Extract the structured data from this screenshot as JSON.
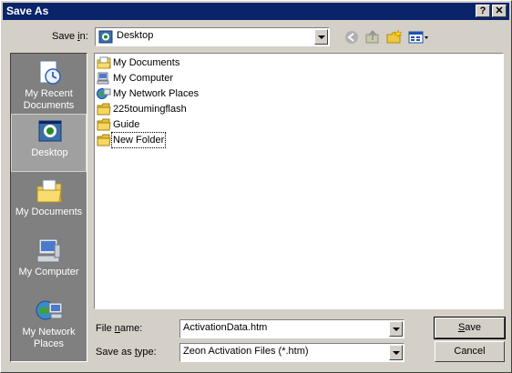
{
  "window": {
    "title": "Save As",
    "help_label": "?",
    "close_label": "✕"
  },
  "save_in": {
    "label_pre": "Save ",
    "label_u": "i",
    "label_post": "n:",
    "value": "Desktop"
  },
  "toolbar": {
    "back": "back-icon",
    "up": "up-folder-icon",
    "new_folder": "new-folder-icon",
    "views": "views-menu-icon"
  },
  "places": [
    {
      "name": "place-my-recent-documents",
      "label_line1": "My Recent",
      "label_line2": "Documents",
      "icon": "recent-documents-icon"
    },
    {
      "name": "place-desktop",
      "label_line1": "Desktop",
      "label_line2": "",
      "icon": "desktop-icon",
      "selected": true
    },
    {
      "name": "place-my-documents",
      "label_line1": "My Documents",
      "label_line2": "",
      "icon": "my-documents-icon"
    },
    {
      "name": "place-my-computer",
      "label_line1": "My Computer",
      "label_line2": "",
      "icon": "my-computer-icon"
    },
    {
      "name": "place-my-network-places",
      "label_line1": "My Network",
      "label_line2": "Places",
      "icon": "network-places-icon"
    }
  ],
  "files": [
    {
      "label": "My Documents",
      "icon": "my-documents-icon"
    },
    {
      "label": "My Computer",
      "icon": "my-computer-icon"
    },
    {
      "label": "My Network Places",
      "icon": "network-places-icon"
    },
    {
      "label": "225toumingflash",
      "icon": "folder-icon"
    },
    {
      "label": "Guide",
      "icon": "folder-icon"
    },
    {
      "label": "New Folder",
      "icon": "folder-icon"
    }
  ],
  "file_name": {
    "label_pre": "File ",
    "label_u": "n",
    "label_post": "ame:",
    "value": "ActivationData.htm"
  },
  "save_as_type": {
    "label_pre": "Save as ",
    "label_u": "t",
    "label_post": "ype:",
    "value": "Zeon Activation Files (*.htm)"
  },
  "buttons": {
    "save_u": "S",
    "save_rest": "ave",
    "cancel": "Cancel"
  }
}
